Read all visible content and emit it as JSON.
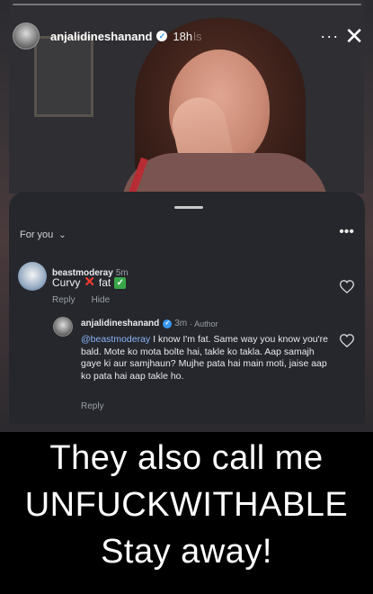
{
  "story": {
    "username": "anjalidineshanand",
    "verified_mark": "✓",
    "time": "18h",
    "time_ghost_text": "ls",
    "more_icon": "more-horizontal-icon",
    "close_icon": "close-icon"
  },
  "comments_sheet": {
    "filter_label": "For you",
    "filter_chevron": "⌄",
    "more_label": "•••",
    "comments": [
      {
        "username": "beastmoderay",
        "time": "5m",
        "text_before": "Curvy",
        "cross_mark": "✕",
        "text_middle": "fat",
        "check_mark": "✓",
        "reply_label": "Reply",
        "hide_label": "Hide"
      }
    ],
    "reply": {
      "username": "anjalidineshanand",
      "verified_mark": "✓",
      "time": "3m",
      "author_label": "· Author",
      "mention": "@beastmoderay",
      "text": " I know I'm fat. Same way you know you're bald. Mote ko mota bolte hai, takle ko takla. Aap samajh gaye ki aur samjhaun? Mujhe pata hai main moti, jaise aap ko pata hai aap takle ho.",
      "reply_label": "Reply"
    }
  },
  "caption": {
    "line1": "They also call me",
    "line2": "UNFUCKWITHABLE",
    "line3": "Stay away!"
  },
  "colors": {
    "sheet_bg": "#25272c",
    "mention": "#8ab4f8",
    "cross": "#ff3b30",
    "check": "#3aa64a",
    "verified_blue": "#3897f0"
  }
}
